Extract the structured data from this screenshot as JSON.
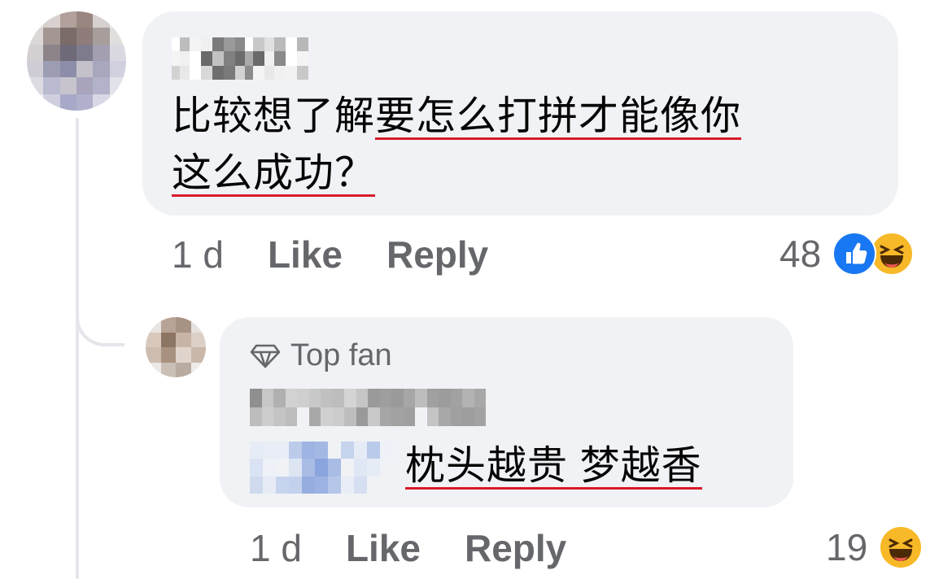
{
  "comment_1": {
    "text_part1": "比较想了解",
    "text_part2": "要怎么打拼才能像你",
    "text_part3": "这么成功？",
    "time": "1 d",
    "like_label": "Like",
    "reply_label": "Reply",
    "reaction_count": "48",
    "reactions": [
      "like-icon",
      "haha-icon"
    ]
  },
  "reply_1": {
    "badge_label": "Top fan",
    "badge_icon": "diamond-icon",
    "text": "枕头越贵 梦越香",
    "time": "1 d",
    "like_label": "Like",
    "reply_label": "Reply",
    "reaction_count": "19",
    "reactions": [
      "haha-icon"
    ]
  },
  "colors": {
    "bubble": "#f0f2f5",
    "meta_text": "#65676b",
    "underline": "#d91a2a",
    "like_blue": "#1877f2",
    "haha_yellow": "#f7b928"
  }
}
